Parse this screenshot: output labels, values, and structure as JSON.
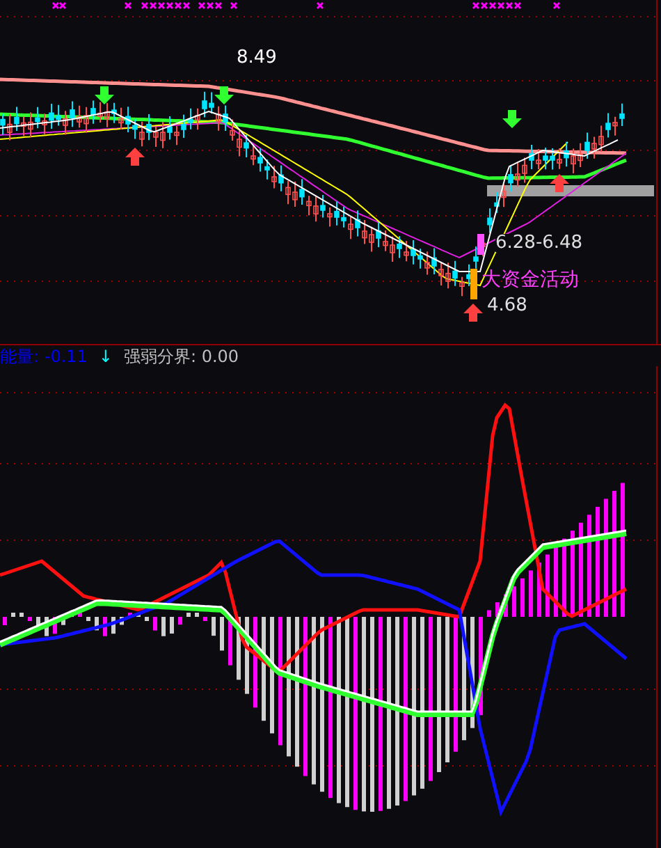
{
  "price_panel": {
    "labels": [
      {
        "kind": "high",
        "text": "8.49"
      },
      {
        "kind": "range",
        "text": "6.28-6.48"
      },
      {
        "kind": "signal",
        "text": "大资金活动"
      },
      {
        "kind": "low",
        "text": "4.68"
      }
    ]
  },
  "indicator_panel": {
    "legend": [
      {
        "text": "能量: -0.11",
        "color": "#0000ff"
      },
      {
        "text": "↓",
        "color": "#00ffff"
      },
      {
        "text": "强弱分界: 0.00",
        "color": "#c0c0c0"
      }
    ]
  }
}
